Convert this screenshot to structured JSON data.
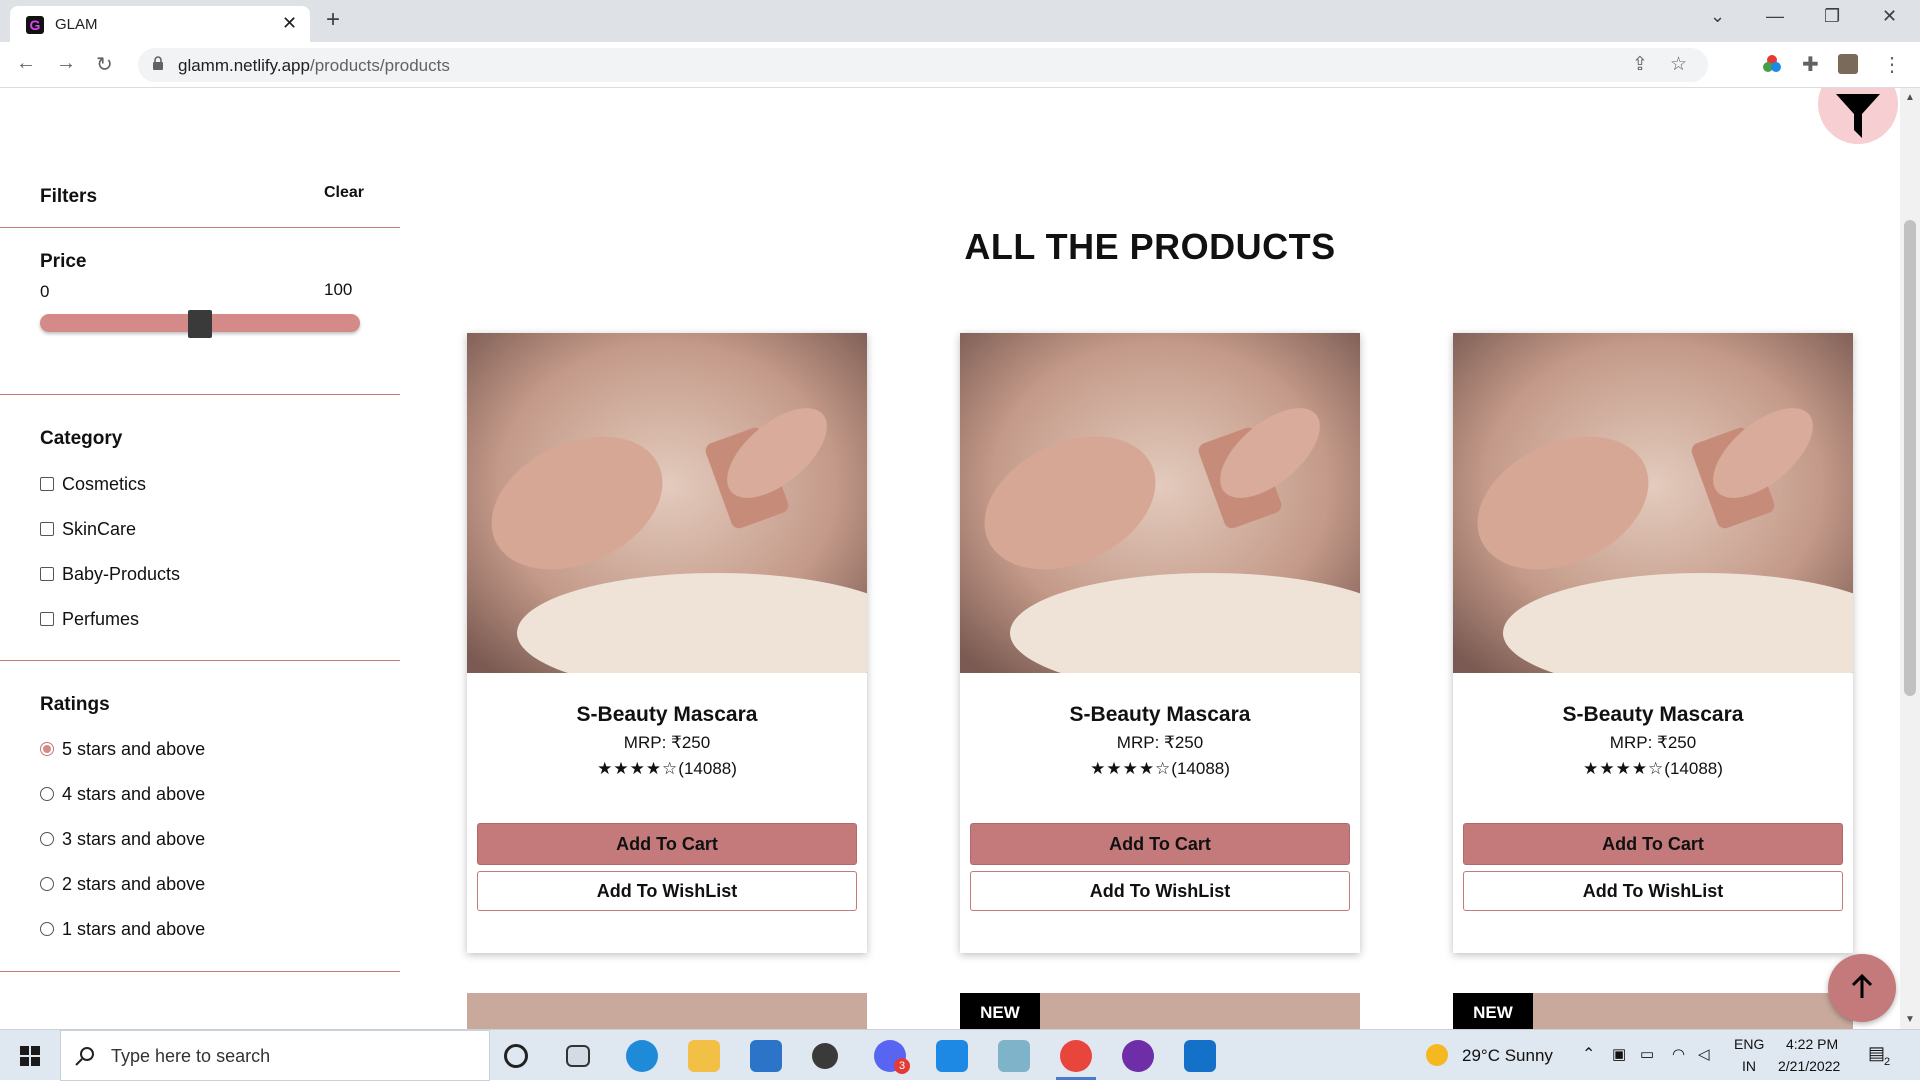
{
  "browser": {
    "tab_title": "GLAM",
    "tab_favicon_letter": "G",
    "url_host": "glamm.netlify.app",
    "url_path": "/products/products"
  },
  "sidebar": {
    "filters_title": "Filters",
    "clear_label": "Clear",
    "price": {
      "title": "Price",
      "min_label": "0",
      "max_label": "100",
      "slider_value_fraction": 0.5
    },
    "category": {
      "title": "Category",
      "options": [
        {
          "label": "Cosmetics",
          "checked": false
        },
        {
          "label": "SkinCare",
          "checked": false
        },
        {
          "label": "Baby-Products",
          "checked": false
        },
        {
          "label": "Perfumes",
          "checked": false
        }
      ]
    },
    "ratings": {
      "title": "Ratings",
      "options": [
        {
          "label": "5 stars and above",
          "checked": true
        },
        {
          "label": "4 stars and above",
          "checked": false
        },
        {
          "label": "3 stars and above",
          "checked": false
        },
        {
          "label": "2 stars and above",
          "checked": false
        },
        {
          "label": "1 stars and above",
          "checked": false
        }
      ]
    }
  },
  "main": {
    "heading": "ALL THE PRODUCTS",
    "products": [
      {
        "name": "S-Beauty Mascara",
        "price": "MRP: ₹250",
        "stars": "★★★★☆",
        "reviews": "(14088)",
        "cart_label": "Add To Cart",
        "wish_label": "Add To WishList"
      },
      {
        "name": "S-Beauty Mascara",
        "price": "MRP: ₹250",
        "stars": "★★★★☆",
        "reviews": "(14088)",
        "cart_label": "Add To Cart",
        "wish_label": "Add To WishList"
      },
      {
        "name": "S-Beauty Mascara",
        "price": "MRP: ₹250",
        "stars": "★★★★☆",
        "reviews": "(14088)",
        "cart_label": "Add To Cart",
        "wish_label": "Add To WishList"
      }
    ],
    "next_row_badges": [
      "",
      "NEW",
      "NEW"
    ]
  },
  "taskbar": {
    "search_placeholder": "Type here to search",
    "weather": "29°C  Sunny",
    "lang_top": "ENG",
    "lang_bottom": "IN",
    "time": "4:22 PM",
    "date": "2/21/2022",
    "notification_count": "2",
    "discord_badge": "3"
  },
  "colors": {
    "accent": "#c4797a",
    "slider": "#d48a89",
    "filter_fab": "#f7cfd3"
  },
  "icons": [
    "lock-icon",
    "filter-icon",
    "arrow-up-icon",
    "search-icon",
    "windows-icon"
  ]
}
